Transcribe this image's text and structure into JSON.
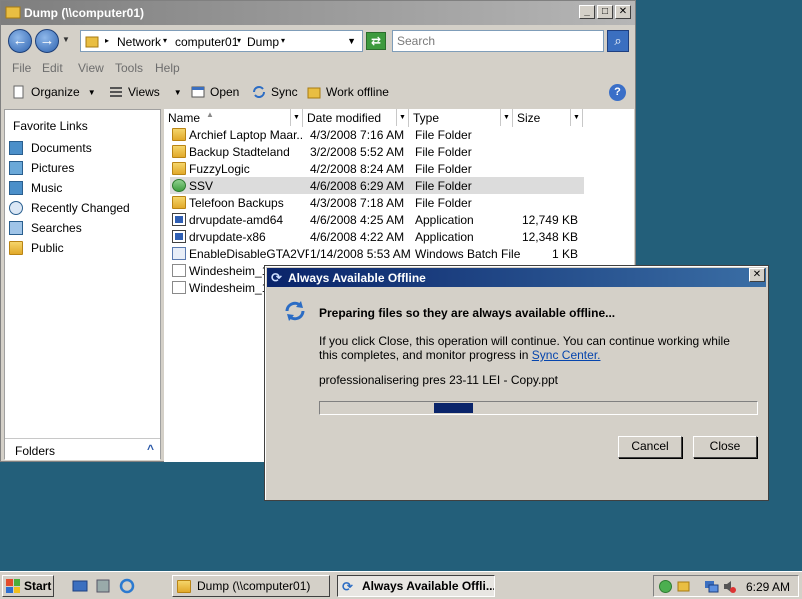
{
  "explorer": {
    "title": "Dump (\\\\computer01)",
    "breadcrumb": [
      "Network",
      "computer01",
      "Dump"
    ],
    "search_placeholder": "Search",
    "menu": [
      "File",
      "Edit",
      "View",
      "Tools",
      "Help"
    ],
    "toolbar": {
      "organize": "Organize",
      "views": "Views",
      "open": "Open",
      "sync": "Sync",
      "work_offline": "Work offline"
    },
    "favorites_title": "Favorite Links",
    "favorites": [
      "Documents",
      "Pictures",
      "Music",
      "Recently Changed",
      "Searches",
      "Public"
    ],
    "folders_label": "Folders",
    "columns": [
      "Name",
      "Date modified",
      "Type",
      "Size"
    ],
    "files": [
      {
        "name": "Archief Laptop Maar...",
        "date": "4/3/2008 7:16 AM",
        "type": "File Folder",
        "size": "",
        "icon": "folder-icon"
      },
      {
        "name": "Backup Stadteland",
        "date": "3/2/2008 5:52 AM",
        "type": "File Folder",
        "size": "",
        "icon": "folder-icon"
      },
      {
        "name": "FuzzyLogic",
        "date": "4/2/2008 8:24 AM",
        "type": "File Folder",
        "size": "",
        "icon": "folder-icon"
      },
      {
        "name": "SSV",
        "date": "4/6/2008 6:29 AM",
        "type": "File Folder",
        "size": "",
        "icon": "sync-folder-icon"
      },
      {
        "name": "Telefoon Backups",
        "date": "4/3/2008 7:18 AM",
        "type": "File Folder",
        "size": "",
        "icon": "folder-icon"
      },
      {
        "name": "drvupdate-amd64",
        "date": "4/6/2008 4:25 AM",
        "type": "Application",
        "size": "12,749 KB",
        "icon": "application-icon"
      },
      {
        "name": "drvupdate-x86",
        "date": "4/6/2008 4:22 AM",
        "type": "Application",
        "size": "12,348 KB",
        "icon": "application-icon"
      },
      {
        "name": "EnableDisableGTA2VPN",
        "date": "1/14/2008 5:53 AM",
        "type": "Windows Batch File",
        "size": "1 KB",
        "icon": "batch-file-icon"
      },
      {
        "name": "Windesheim_11",
        "date": "",
        "type": "",
        "size": "",
        "icon": "document-icon"
      },
      {
        "name": "Windesheim_13",
        "date": "",
        "type": "",
        "size": "",
        "icon": "document-icon"
      }
    ]
  },
  "dialog": {
    "title": "Always Available Offline",
    "heading": "Preparing files so they are always available offline...",
    "body_text": "If you click Close, this operation will continue.  You can continue working while this completes, and monitor progress in",
    "link": "Sync Center.",
    "current_file": "professionalisering pres 23-11 LEI - Copy.ppt",
    "progress_fraction": 0.1,
    "cancel_label": "Cancel",
    "close_label": "Close"
  },
  "taskbar": {
    "start_label": "Start",
    "tasks": [
      "Dump (\\\\computer01)",
      "Always Available Offli..."
    ],
    "clock": "6:29 AM"
  },
  "colors": {
    "desktop": "#235f7a",
    "dialog_title": "#0a246a",
    "progress": "#0a246a"
  }
}
